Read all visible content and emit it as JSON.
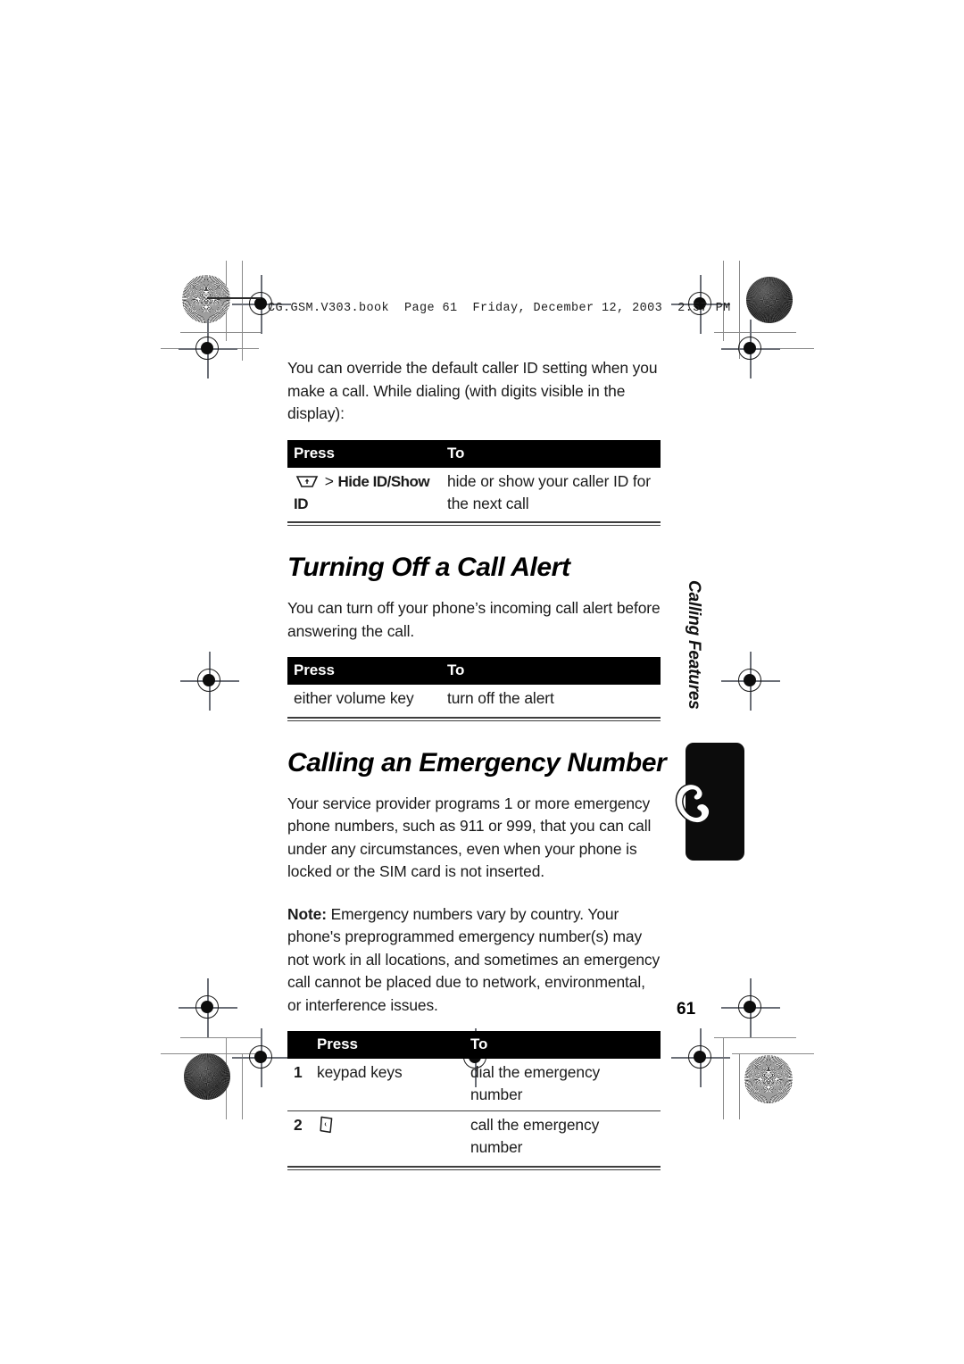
{
  "print_marks": {
    "book_header": "CG.GSM.V303.book  Page 61  Friday, December 12, 2003  2:57 PM"
  },
  "content": {
    "intro_paragraph": "You can override the default caller ID setting when you make a call. While dialing (with digits visible in the display):",
    "table_caller_id": {
      "headers": {
        "press": "Press",
        "to": "To"
      },
      "rows": [
        {
          "press_icon": "softkey-icon",
          "press_separator": ">",
          "press_bold": "Hide ID/Show ID",
          "to": "hide or show your caller ID for the next call"
        }
      ]
    },
    "heading_call_alert": "Turning Off a Call Alert",
    "call_alert_paragraph": "You can turn off your phone’s incoming call alert before answering the call.",
    "table_call_alert": {
      "headers": {
        "press": "Press",
        "to": "To"
      },
      "rows": [
        {
          "press": "either volume key",
          "to": "turn off the alert"
        }
      ]
    },
    "heading_emergency": "Calling an Emergency Number",
    "emergency_paragraph": "Your service provider programs 1 or more emergency phone numbers, such as 911 or 999, that you can call under any circumstances, even when your phone is locked or the SIM card is not inserted.",
    "note_label": "Note:",
    "note_text": "Emergency numbers vary by country. Your phone's preprogrammed emergency number(s) may not work in all locations, and sometimes an emergency call cannot be placed due to network, environmental, or interference issues.",
    "table_emergency": {
      "headers": {
        "num": "",
        "press": "Press",
        "to": "To"
      },
      "rows": [
        {
          "num": "1",
          "press": "keypad keys",
          "press_icon": "",
          "to": "dial the emergency number"
        },
        {
          "num": "2",
          "press": "",
          "press_icon": "send-key-icon",
          "to": "call the emergency number"
        }
      ]
    }
  },
  "side_tab": {
    "label": "Calling Features",
    "icon": "phone-handset-icon"
  },
  "footer": {
    "page_number": "61"
  }
}
